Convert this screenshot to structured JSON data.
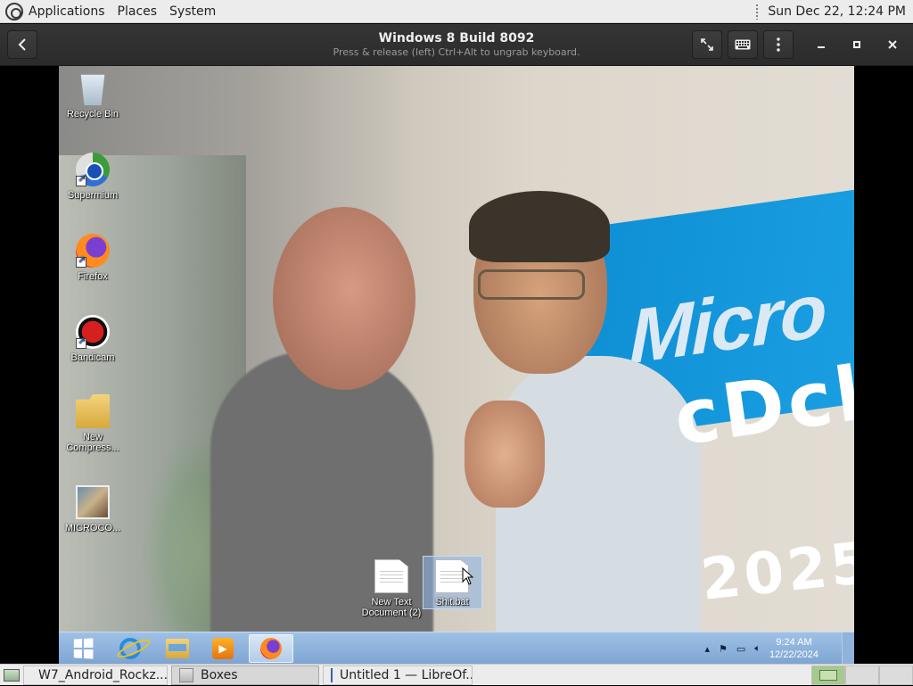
{
  "top_panel": {
    "menus": [
      "Applications",
      "Places",
      "System"
    ],
    "clock": "Sun Dec 22, 12:24 PM"
  },
  "boxes_window": {
    "title": "Windows 8 Build 8092",
    "subtitle": "Press & release (left) Ctrl+Alt to ungrab keyboard.",
    "icons": [
      "back-icon",
      "fullscreen-icon",
      "keyboard-icon",
      "menu-icon",
      "minimize-icon",
      "maximize-icon",
      "close-icon"
    ]
  },
  "vm_desktop": {
    "icons": [
      {
        "label": "Recycle Bin",
        "icon": "recycle-bin-icon"
      },
      {
        "label": "Supermium",
        "icon": "supermium-icon"
      },
      {
        "label": "Firefox",
        "icon": "firefox-icon"
      },
      {
        "label": "Bandicam",
        "icon": "bandicam-icon"
      },
      {
        "label": "New Compress...",
        "icon": "zip-folder-icon"
      },
      {
        "label": "MICROCO...",
        "icon": "image-file-icon"
      }
    ],
    "files": [
      {
        "label": "New Text Document (2)",
        "icon": "text-file-icon"
      },
      {
        "label": "Shit.bat",
        "icon": "batch-file-icon"
      }
    ],
    "wallpaper_text": "Micro",
    "handwriting": [
      "cDck",
      "2025"
    ]
  },
  "vm_taskbar": {
    "pinned": [
      "start-icon",
      "internet-explorer-icon",
      "file-explorer-icon",
      "media-player-icon",
      "firefox-icon"
    ],
    "clock_time": "9:24 AM",
    "clock_date": "12/22/2024"
  },
  "bottom_panel": {
    "tasks": [
      {
        "label": "W7_Android_Rockz...",
        "icon": "chrome-icon"
      },
      {
        "label": "Boxes",
        "icon": "boxes-icon"
      },
      {
        "label": "Untitled 1 — LibreOf...",
        "icon": "writer-icon"
      }
    ]
  }
}
